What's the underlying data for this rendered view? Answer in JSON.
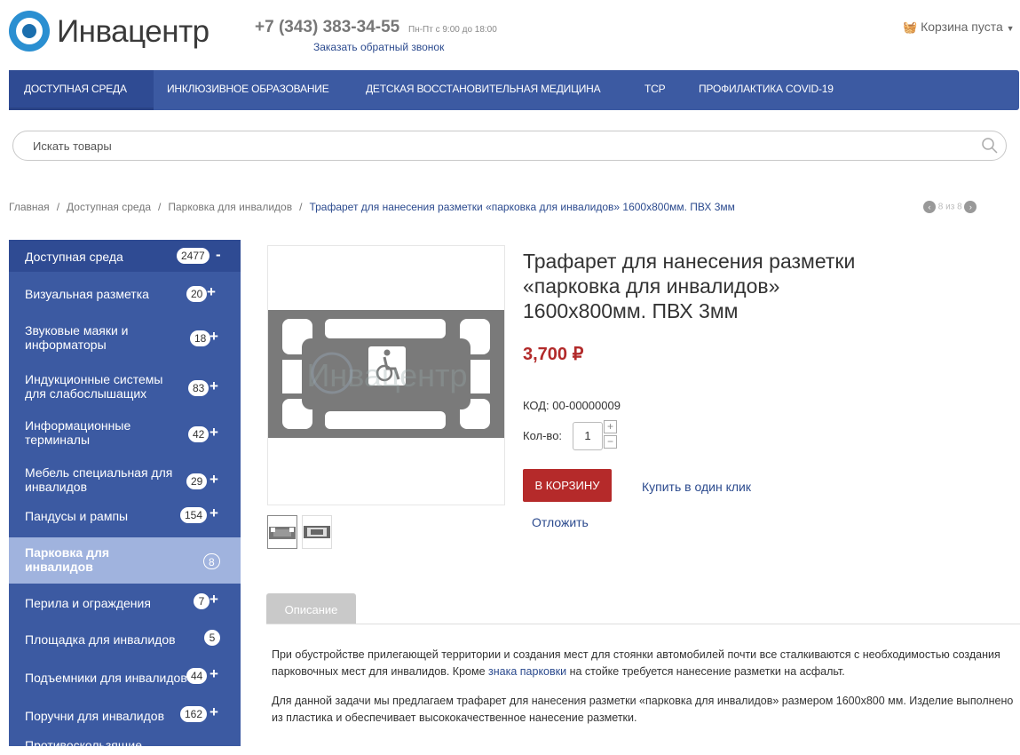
{
  "header": {
    "logo_text": "Инвацентр",
    "phone": "+7 (343) 383-34-55",
    "hours": "Пн-Пт с 9:00 до 18:00",
    "callback": "Заказать обратный звонок",
    "cart": "Корзина пуста"
  },
  "nav": {
    "items": [
      {
        "label": "ДОСТУПНАЯ СРЕДА"
      },
      {
        "label": "ИНКЛЮЗИВНОЕ ОБРАЗОВАНИЕ"
      },
      {
        "label": "ДЕТСКАЯ ВОССТАНОВИТЕЛЬНАЯ МЕДИЦИНА"
      },
      {
        "label": "ТСР"
      },
      {
        "label": "ПРОФИЛАКТИКА COVID-19"
      }
    ]
  },
  "search": {
    "placeholder": "Искать товары"
  },
  "breadcrumb": {
    "items": [
      "Главная",
      "Доступная среда",
      "Парковка для инвалидов"
    ],
    "separator": "/",
    "current": "Трафарет для нанесения разметки «парковка для инвалидов» 1600х800мм. ПВХ 3мм",
    "pager": "8 из 8"
  },
  "sidebar": {
    "top": {
      "label": "Доступная среда",
      "count": "2477",
      "toggle": "-"
    },
    "items": [
      {
        "label": "Визуальная разметка",
        "count": "20",
        "toggle": "+"
      },
      {
        "label": "Звуковые маяки и информаторы",
        "count": "18",
        "toggle": "+"
      },
      {
        "label": "Индукционные системы для слабослышащих",
        "count": "83",
        "toggle": "+"
      },
      {
        "label": "Информационные терминалы",
        "count": "42",
        "toggle": "+"
      },
      {
        "label": "Мебель специальная для инвалидов",
        "count": "29",
        "toggle": "+"
      },
      {
        "label": "Пандусы и рампы",
        "count": "154",
        "toggle": "+"
      },
      {
        "label": "Парковка для инвалидов",
        "count": "8",
        "toggle": ""
      },
      {
        "label": "Перила и ограждения",
        "count": "7",
        "toggle": "+"
      },
      {
        "label": "Площадка для инвалидов",
        "count": "5",
        "toggle": ""
      },
      {
        "label": "Подъемники для инвалидов",
        "count": "44",
        "toggle": "+"
      },
      {
        "label": "Поручни для инвалидов",
        "count": "162",
        "toggle": "+"
      },
      {
        "label": "Противоскользящие",
        "count": "",
        "toggle": ""
      }
    ]
  },
  "product": {
    "title": "Трафарет для нанесения разметки «парковка для инвалидов» 1600х800мм. ПВХ 3мм",
    "price": "3,700 ₽",
    "code_label": "КОД:",
    "code": "00-00000009",
    "qty_label": "Кол-во:",
    "qty": "1",
    "buy": "В КОРЗИНУ",
    "one_click": "Купить в один клик",
    "later": "Отложить",
    "watermark": "Инвацентр"
  },
  "tabs": {
    "description": "Описание"
  },
  "description": {
    "p1_a": "При обустройстве прилегающей территории и создания мест для стоянки автомобилей почти все сталкиваются с необходимостью создания парковочных мест для инвалидов. Кроме ",
    "p1_link": "знака парковки",
    "p1_b": " на стойке требуется нанесение разметки на асфальт.",
    "p2": "Для данной задачи мы предлагаем трафарет для нанесения разметки «парковка для инвалидов» размером 1600х800 мм. Изделие выполнено из пластика и обеспечивает высококачественное нанесение разметки."
  },
  "colors": {
    "nav": "#3c5aa2",
    "accent": "#b52a2a",
    "link": "#2b4a8e"
  }
}
